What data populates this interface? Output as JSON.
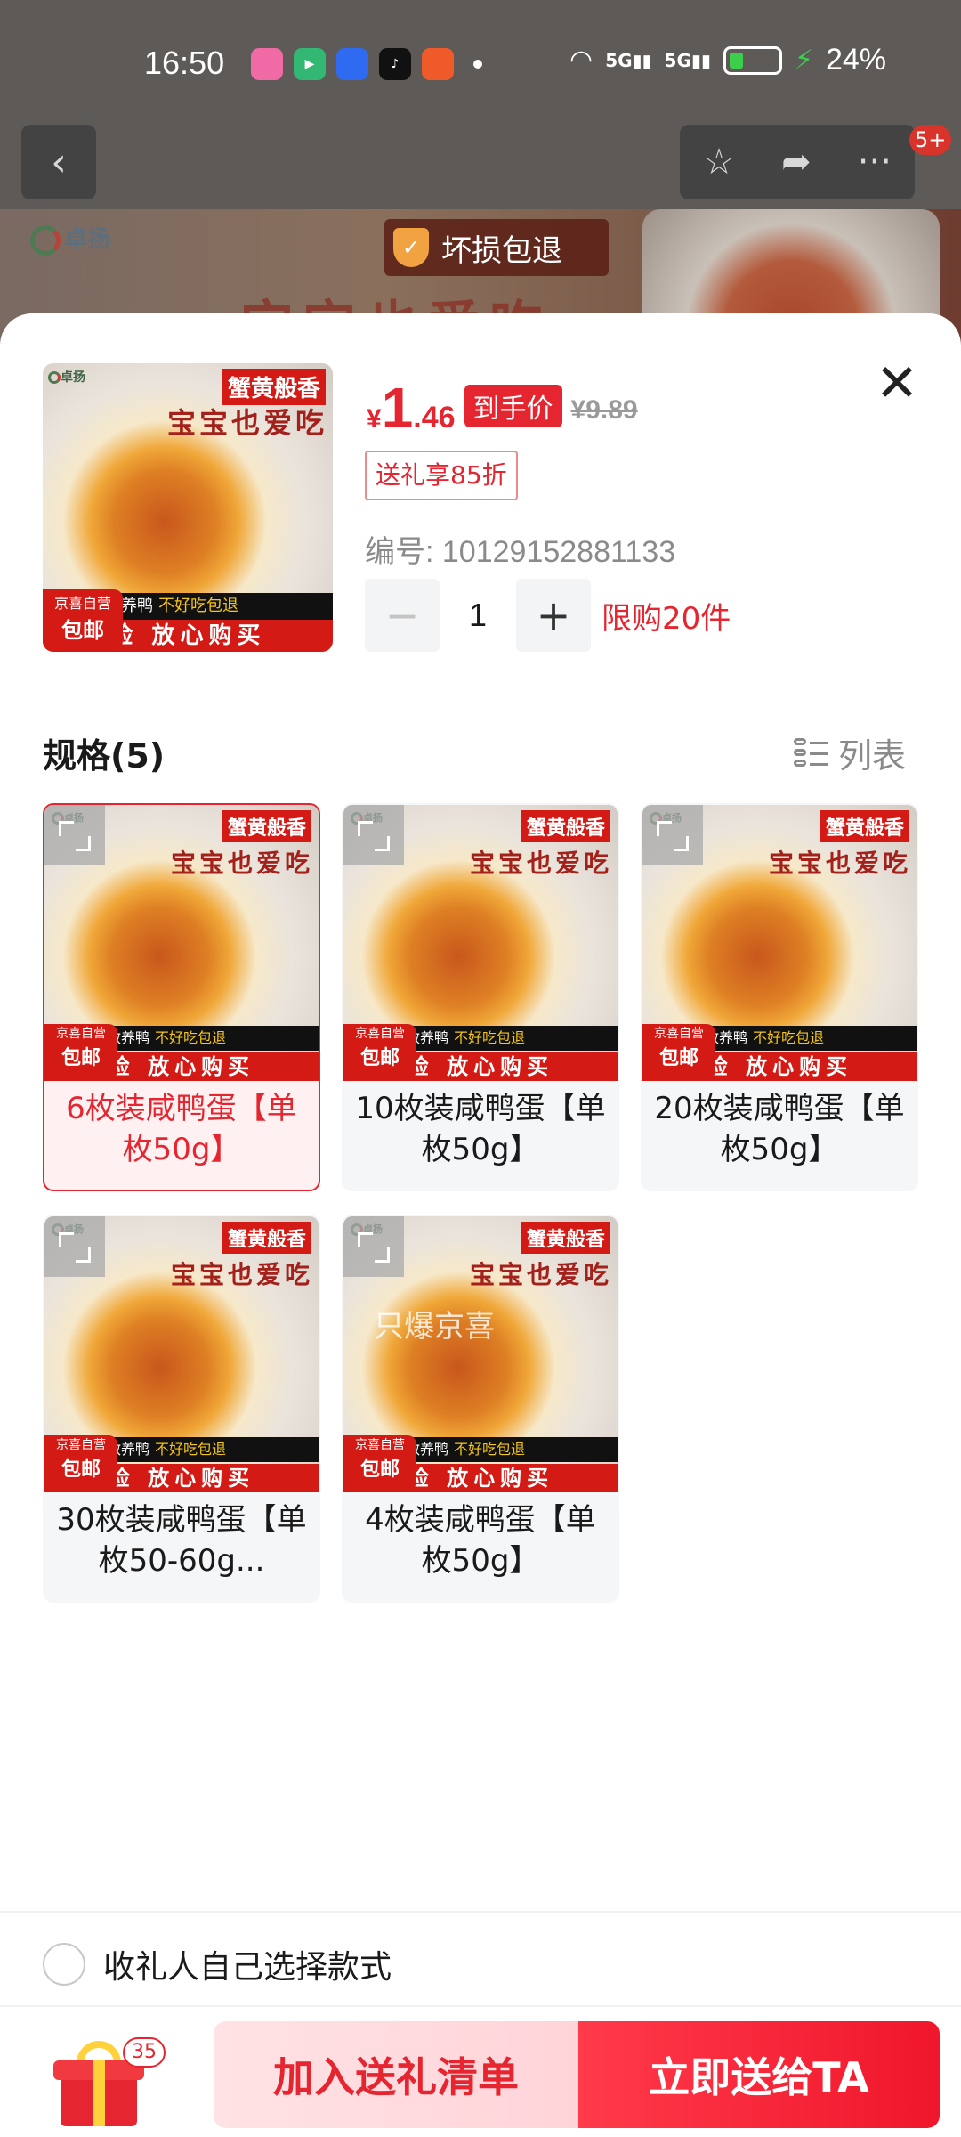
{
  "status_bar": {
    "time": "16:50",
    "network_1": "5G",
    "network_2": "5G",
    "battery_percent": "24%",
    "battery_level": 0.24,
    "apps": [
      "app-1",
      "app-2",
      "app-3",
      "app-4",
      "app-5"
    ]
  },
  "background_page": {
    "guarantee_label": "坏损包退",
    "notification_badge": "5+",
    "brand_logo_text": "卓扬",
    "banner_text": "宝宝也爱吃"
  },
  "product": {
    "price_currency": "¥",
    "price_integer": "1",
    "price_decimal": ".46",
    "price_tag": "到手价",
    "original_price": "¥9.89",
    "discount_label": "送礼享85折",
    "sku_number": "编号: 10129152881133",
    "quantity": "1",
    "minus_symbol": "−",
    "plus_symbol": "+",
    "limit_text": "限购20件",
    "close_symbol": "✕"
  },
  "thumbnail": {
    "logo": "卓扬",
    "tag": "蟹黄般香",
    "slogan": "宝宝也爱吃",
    "strip_left": "散养鸭",
    "strip_right": "不好吃包退",
    "bar": "检 放心购买",
    "jd_top": "京喜自营",
    "jd_bottom": "包邮"
  },
  "specs": {
    "title": "规格(5)",
    "view_toggle_label": "列表",
    "items": [
      {
        "label": "6枚装咸鸭蛋【单枚50g】",
        "selected": true
      },
      {
        "label": "10枚装咸鸭蛋【单枚50g】",
        "selected": false
      },
      {
        "label": "20枚装咸鸭蛋【单枚50g】",
        "selected": false
      },
      {
        "label": "30枚装咸鸭蛋【单枚50-60g...",
        "selected": false
      },
      {
        "label": "4枚装咸鸭蛋【单枚50g】",
        "selected": false
      }
    ],
    "watermark": "只爆京喜"
  },
  "options": {
    "recipient_choice_label": "收礼人自己选择款式"
  },
  "bottom_bar": {
    "gift_count": "35",
    "add_to_list_label": "加入送礼清单",
    "send_now_label": "立即送给TA"
  },
  "colors": {
    "accent_red": "#e5252f",
    "selected_card_bg": "#fff1f2",
    "card_bg": "#f5f6f8"
  }
}
